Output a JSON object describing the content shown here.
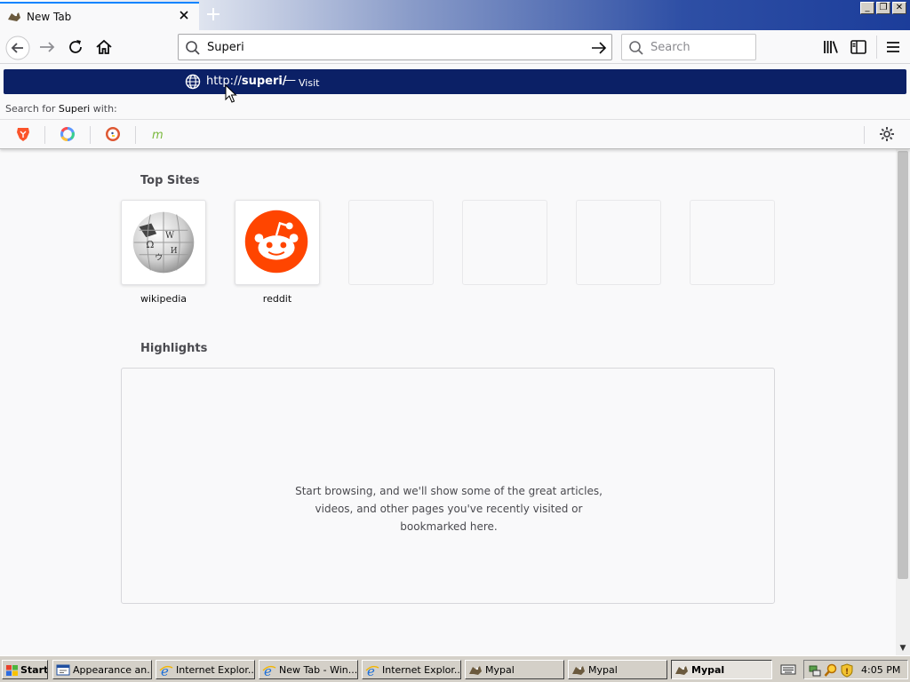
{
  "tab": {
    "title": "New Tab"
  },
  "window_buttons": {
    "minimize": "_",
    "restore": "❐",
    "close": "✕"
  },
  "navbar": {
    "url_value": "Superi",
    "search_placeholder": "Search"
  },
  "autocomplete": {
    "selected": {
      "url_prefix": "http://",
      "url_bold": "superi/",
      "separator": "—",
      "action": "Visit"
    },
    "search_with": {
      "prefix": "Search for ",
      "term": "Superi",
      "suffix": " with:"
    },
    "engines": [
      "brave-icon",
      "qwant-icon",
      "duckduckgo-icon",
      "mojeek-icon"
    ]
  },
  "content": {
    "top_sites_title": "Top Sites",
    "top_sites": [
      {
        "label": "wikipedia",
        "icon": "wikipedia-icon"
      },
      {
        "label": "reddit",
        "icon": "reddit-icon"
      },
      {
        "label": ""
      },
      {
        "label": ""
      },
      {
        "label": ""
      },
      {
        "label": ""
      }
    ],
    "highlights_title": "Highlights",
    "highlights_message_1": "Start browsing, and we'll show some of the great articles,",
    "highlights_message_2": "videos, and other pages you've recently visited or",
    "highlights_message_3": "bookmarked here."
  },
  "taskbar": {
    "start_label": "Start",
    "buttons": [
      {
        "label": "Appearance an...",
        "icon": "appearance-icon"
      },
      {
        "label": "Internet Explor...",
        "icon": "ie-icon"
      },
      {
        "label": "New Tab - Win...",
        "icon": "ie-icon"
      },
      {
        "label": "Internet Explor...",
        "icon": "ie-icon"
      },
      {
        "label": "Mypal",
        "icon": "mypal-icon"
      },
      {
        "label": "Mypal",
        "icon": "mypal-icon"
      },
      {
        "label": "Mypal",
        "icon": "mypal-icon",
        "active": true
      }
    ],
    "clock": "4:05 PM"
  },
  "colors": {
    "selection": "#0b2066",
    "reddit": "#ff4500",
    "accent": "#0a84ff"
  }
}
